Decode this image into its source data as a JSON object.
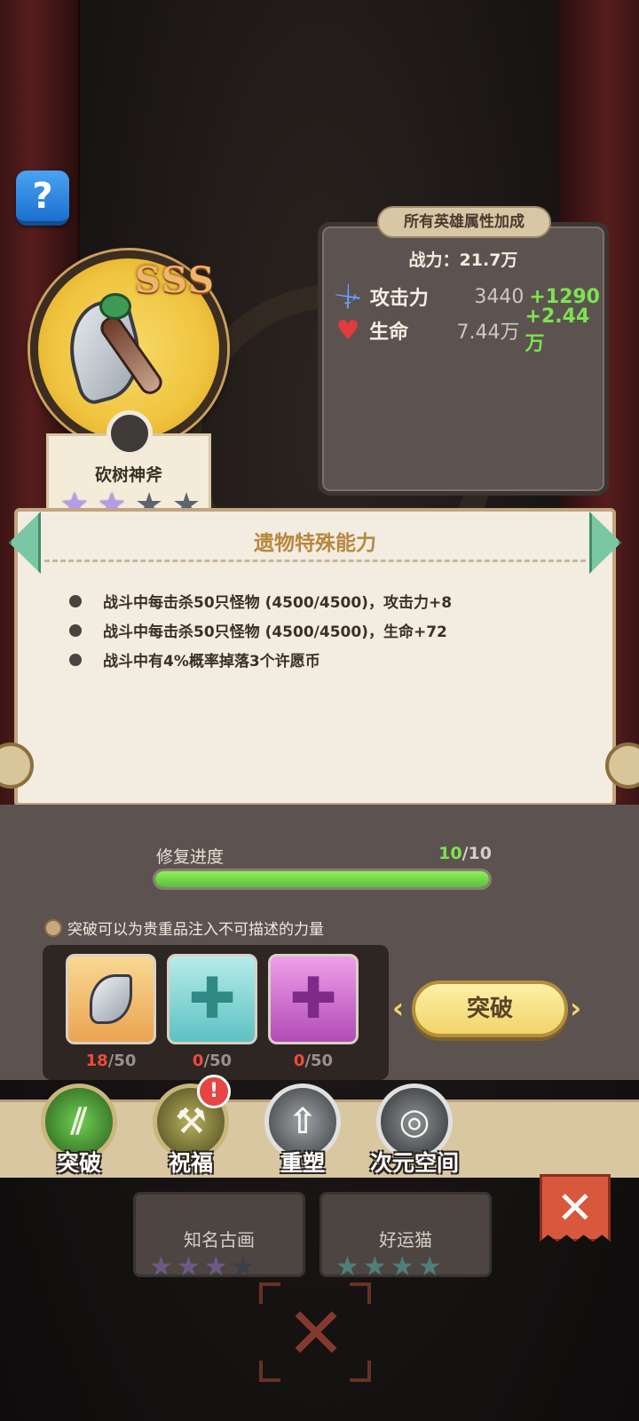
{
  "help": {
    "icon": "question-mark-icon",
    "glyph": "?"
  },
  "relic": {
    "grade": "SSS",
    "name": "砍树神斧",
    "stars_filled": 2,
    "stars_total": 4
  },
  "bonus": {
    "title": "所有英雄属性加成",
    "power": "战力：21.7万",
    "stats": [
      {
        "icon": "sword-icon",
        "label": "攻击力",
        "value": "3440",
        "bonus": "+1290"
      },
      {
        "icon": "heart-icon",
        "label": "生命",
        "value": "7.44万",
        "bonus": "+2.44万"
      }
    ]
  },
  "ability": {
    "title": "遗物特殊能力",
    "items": [
      "战斗中每击杀50只怪物 (4500/4500)，攻击力+8",
      "战斗中每击杀50只怪物 (4500/4500)，生命+72",
      "战斗中有4%概率掉落3个许愿币"
    ]
  },
  "repair": {
    "label": "修复进度",
    "current": "10",
    "total": "/10",
    "progress": 1.0
  },
  "hint": "突破可以为贵重品注入不可描述的力量",
  "materials": [
    {
      "kind": "axe-relic-icon",
      "have": "18",
      "need": "/50"
    },
    {
      "kind": "teal-plus-icon",
      "have": "0",
      "need": "/50"
    },
    {
      "kind": "pink-plus-icon",
      "have": "0",
      "need": "/50"
    }
  ],
  "break_button": "突破",
  "tabs": [
    {
      "label": "突破",
      "icon": "claw-icon",
      "badge": false
    },
    {
      "label": "祝福",
      "icon": "hammer-icon",
      "badge": true,
      "badge_text": "!"
    },
    {
      "label": "重塑",
      "icon": "upgrade-arrow-icon",
      "badge": false
    },
    {
      "label": "次元空间",
      "icon": "planet-icon",
      "badge": false
    }
  ],
  "cards": [
    {
      "name": "知名古画",
      "stars_filled": 3,
      "stars_total": 4
    },
    {
      "name": "好运猫",
      "stars_filled": 4,
      "stars_total": 4
    }
  ],
  "close": {
    "glyph": "✕"
  },
  "colors": {
    "panel": "#5c5350",
    "accent_green": "#7ee34e",
    "accent_red": "#f04a3a",
    "button_gold": "#f1d46a"
  }
}
